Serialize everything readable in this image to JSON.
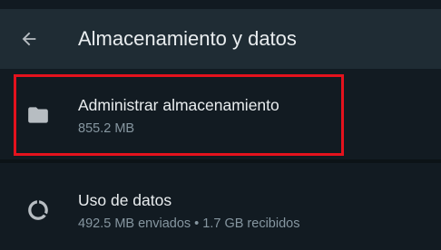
{
  "header": {
    "title": "Almacenamiento y datos",
    "back_icon": "arrow-back-icon"
  },
  "items": [
    {
      "title": "Administrar almacenamiento",
      "subtitle": "855.2 MB",
      "icon": "folder-icon",
      "highlighted": true
    },
    {
      "title": "Uso de datos",
      "subtitle": "492.5 MB enviados • 1.7 GB recibidos",
      "icon": "data-usage-circle-icon",
      "highlighted": false
    }
  ],
  "colors": {
    "background": "#121b22",
    "app_bar": "#1f2c34",
    "primary_text": "#e9edef",
    "secondary_text": "#8696a0",
    "icon": "#b7bdc2",
    "highlight": "#e4121d"
  }
}
